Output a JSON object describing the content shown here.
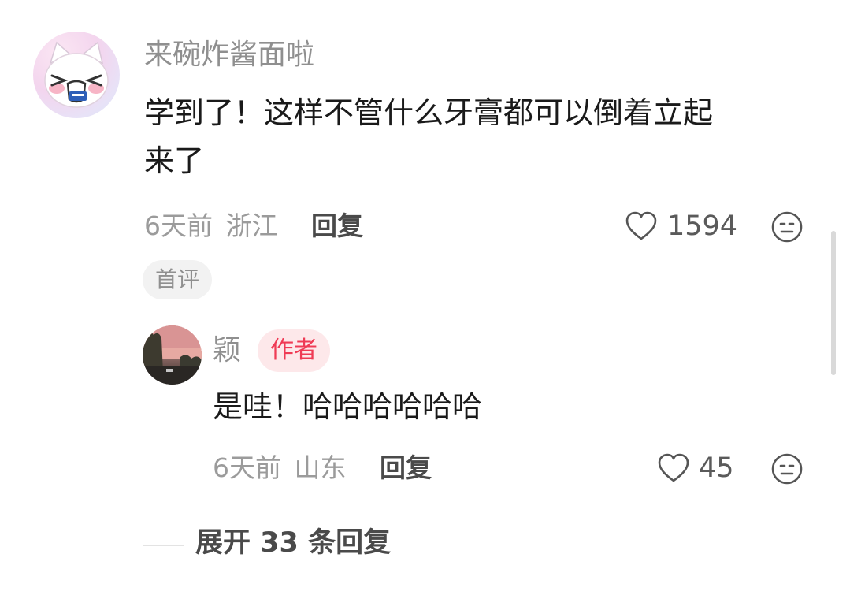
{
  "comment": {
    "username": "来碗炸酱面啦",
    "text_line1": "学到了！这样不管什么牙膏都可以倒着立起",
    "text_line2": "来了",
    "time": "6天前",
    "location": "浙江",
    "reply_label": "回复",
    "like_count": "1594",
    "badge": "首评"
  },
  "reply": {
    "username": "颖",
    "author_badge": "作者",
    "text": "是哇！哈哈哈哈哈哈",
    "time": "6天前",
    "location": "山东",
    "reply_label": "回复",
    "like_count": "45"
  },
  "expand_label": "展开 33 条回复",
  "icons": {
    "like": "heart-outline-icon",
    "dislike": "meh-face-icon"
  },
  "colors": {
    "author_badge_text": "#ef3b55",
    "author_badge_bg": "#fde8ea"
  }
}
